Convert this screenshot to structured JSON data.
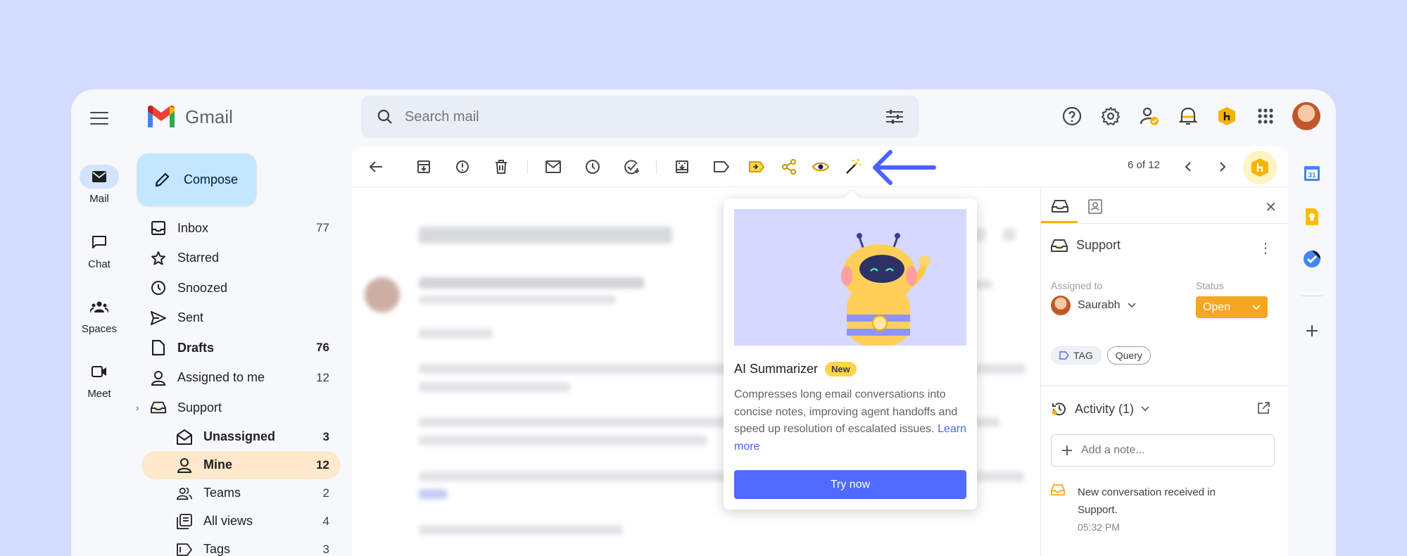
{
  "app": {
    "name": "Gmail"
  },
  "colors": {
    "background": "#d3dcff",
    "compose": "#c2e7ff",
    "active_nav": "#ffe8cc",
    "status_open": "#f5a623",
    "accent_button": "#4f6bff",
    "new_badge": "#ffd54a",
    "arrow": "#4a63ff"
  },
  "rail": [
    {
      "label": "Mail",
      "icon": "mail-icon",
      "active": true
    },
    {
      "label": "Chat",
      "icon": "chat-icon",
      "active": false
    },
    {
      "label": "Spaces",
      "icon": "spaces-icon",
      "active": false
    },
    {
      "label": "Meet",
      "icon": "meet-icon",
      "active": false
    }
  ],
  "search": {
    "placeholder": "Search mail"
  },
  "compose": {
    "label": "Compose"
  },
  "nav": [
    {
      "label": "Inbox",
      "count": "77",
      "icon": "inbox-icon"
    },
    {
      "label": "Starred",
      "count": "",
      "icon": "star-icon"
    },
    {
      "label": "Snoozed",
      "count": "",
      "icon": "clock-icon"
    },
    {
      "label": "Sent",
      "count": "",
      "icon": "send-icon"
    },
    {
      "label": "Drafts",
      "count": "76",
      "icon": "draft-icon"
    },
    {
      "label": "Assigned to me",
      "count": "12",
      "icon": "person-icon"
    },
    {
      "label": "Support",
      "count": "",
      "icon": "support-inbox-icon"
    },
    {
      "label": "Unassigned",
      "count": "3",
      "icon": "open-mail-icon"
    },
    {
      "label": "Mine",
      "count": "12",
      "icon": "person-icon"
    },
    {
      "label": "Teams",
      "count": "2",
      "icon": "teams-icon"
    },
    {
      "label": "All views",
      "count": "4",
      "icon": "views-icon"
    },
    {
      "label": "Tags",
      "count": "3",
      "icon": "tag-icon"
    }
  ],
  "toolbar": {
    "pager": "6 of 12"
  },
  "panel": {
    "inbox_name": "Support",
    "assigned_label": "Assigned to",
    "assignee": "Saurabh",
    "status_label": "Status",
    "status_value": "Open",
    "tags": [
      "TAG",
      "Query"
    ],
    "activity_title": "Activity (1)",
    "note_placeholder": "Add a note...",
    "event_text": "New conversation received in Support.",
    "event_time": "05:32 PM"
  },
  "popup": {
    "title": "AI Summarizer",
    "badge": "New",
    "description": "Compresses long email conversations into concise notes, improving agent handoffs and speed up resolution of escalated issues.",
    "learn_more": "Learn more",
    "cta": "Try now"
  }
}
